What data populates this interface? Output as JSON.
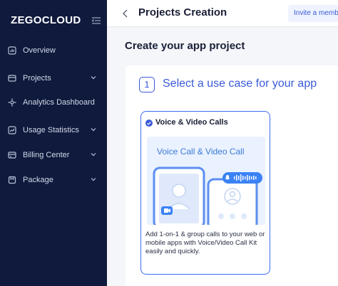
{
  "sidebar": {
    "logo": "ZEGOCLOUD",
    "items": [
      {
        "label": "Overview",
        "has_chevron": false
      },
      {
        "label": "Projects",
        "has_chevron": true
      },
      {
        "label": "Analytics Dashboard",
        "has_chevron": false
      },
      {
        "label": "Usage Statistics",
        "has_chevron": true
      },
      {
        "label": "Billing Center",
        "has_chevron": true
      },
      {
        "label": "Package",
        "has_chevron": true
      }
    ],
    "colors": {
      "background": "#0f1a3d",
      "text": "#d3d9e8"
    }
  },
  "header": {
    "title": "Projects Creation",
    "invite_label": "Invite a membe"
  },
  "main": {
    "heading": "Create your app project",
    "step": {
      "number": "1",
      "title": "Select a use case for your app"
    },
    "card": {
      "title": "Voice & Video Calls",
      "illustration_title": "Voice Call & Video Call",
      "description": "Add 1-on-1 & group calls to your web or mobile apps with Voice/Video Call Kit easily and quickly.",
      "selected": true
    },
    "accent_color": "#3a5bd9"
  }
}
